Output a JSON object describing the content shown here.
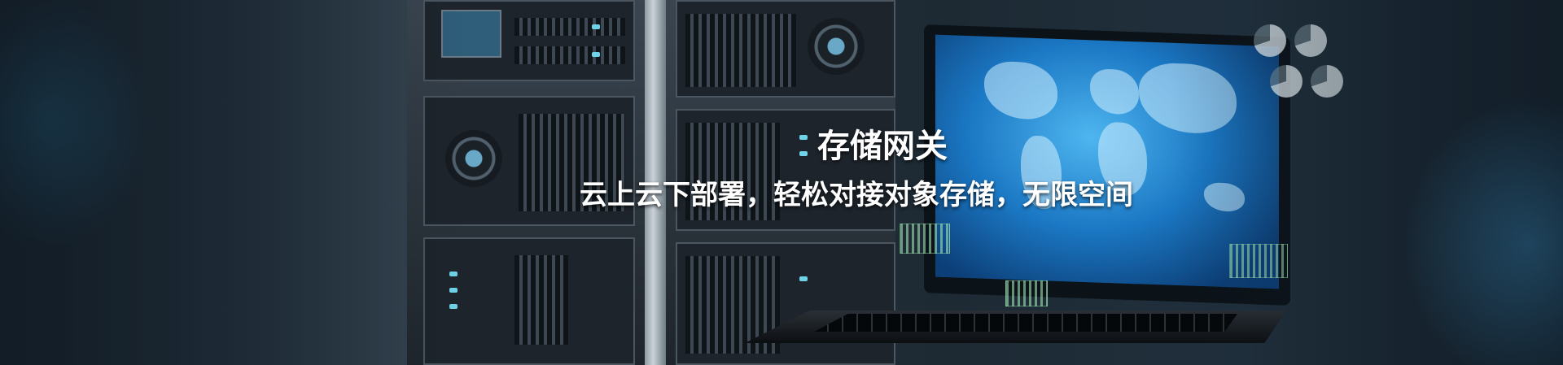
{
  "banner": {
    "title": "存储网关",
    "subtitle": "云上云下部署，轻松对接对象存储，无限空间"
  },
  "colors": {
    "text": "#ffffff",
    "accent_blue": "#1b78c4",
    "background": "#1a2530"
  }
}
